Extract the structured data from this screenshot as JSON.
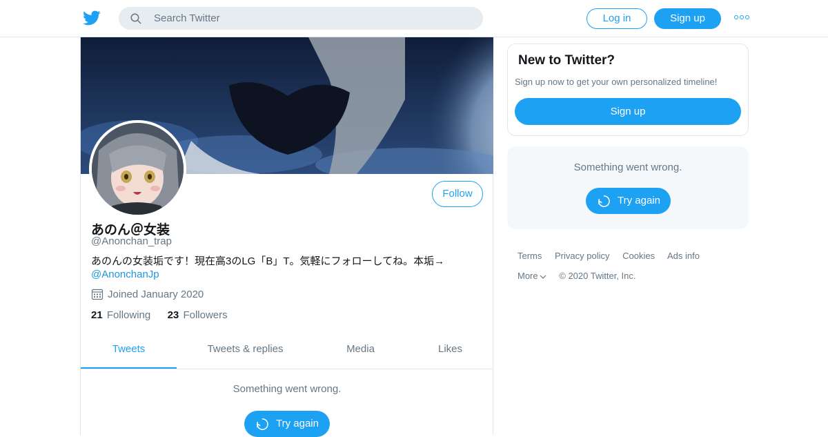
{
  "header": {
    "logo_icon": "twitter-bird-icon",
    "search_placeholder": "Search Twitter",
    "login_label": "Log in",
    "signup_label": "Sign up",
    "more_icon": "more-dots-icon"
  },
  "profile": {
    "display_name": "あのん＠女装",
    "handle": "@Anonchan_trap",
    "bio_text": "あのんの女装垢です！現在高3のLG「B」T。気軽にフォローしてね。本垢→",
    "bio_link": "@AnonchanJp",
    "joined": "Joined January 2020",
    "following_count": "21",
    "following_label": "Following",
    "followers_count": "23",
    "followers_label": "Followers",
    "follow_label": "Follow"
  },
  "tabs": [
    {
      "label": "Tweets",
      "active": true
    },
    {
      "label": "Tweets & replies",
      "active": false
    },
    {
      "label": "Media",
      "active": false
    },
    {
      "label": "Likes",
      "active": false
    }
  ],
  "timeline": {
    "error_message": "Something went wrong.",
    "retry_label": "Try again"
  },
  "sidebar": {
    "new_title": "New to Twitter?",
    "new_subtitle": "Sign up now to get your own personalized timeline!",
    "signup_label": "Sign up",
    "error_message": "Something went wrong.",
    "retry_label": "Try again"
  },
  "footer": {
    "links": [
      "Terms",
      "Privacy policy",
      "Cookies",
      "Ads info"
    ],
    "more_label": "More",
    "copyright": "© 2020 Twitter, Inc."
  },
  "colors": {
    "accent": "#1da1f2",
    "secondary_text": "#657786",
    "border": "#e1e8ed"
  }
}
